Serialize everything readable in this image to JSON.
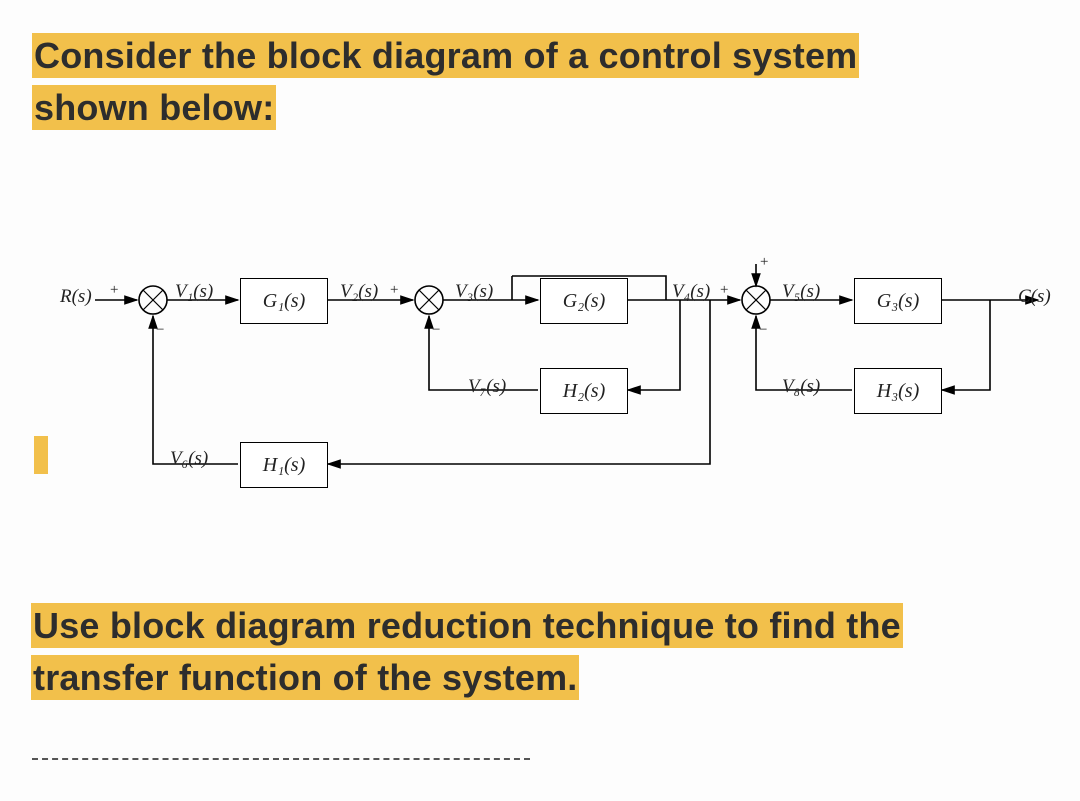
{
  "heading_top_line1": "Consider the block diagram of a control system",
  "heading_top_line2": "shown below:",
  "heading_bot_line1": "Use block diagram reduction technique to find the",
  "heading_bot_line2": "transfer function of the system.",
  "io": {
    "R": "R(s)",
    "C": "C(s)"
  },
  "signals": {
    "V1": "V₁(s)",
    "V2": "V₂(s)",
    "V3": "V₃(s)",
    "V4": "V₄(s)",
    "V5": "V₅(s)",
    "V6": "V₆(s)",
    "V7": "V₇(s)",
    "V8": "V₈(s)"
  },
  "signs": {
    "plus": "+",
    "minus": "−"
  },
  "blocks": {
    "G1": "G₁(s)",
    "G2": "G₂(s)",
    "G3": "G₃(s)",
    "H1": "H₁(s)",
    "H2": "H₂(s)",
    "H3": "H₃(s)"
  }
}
